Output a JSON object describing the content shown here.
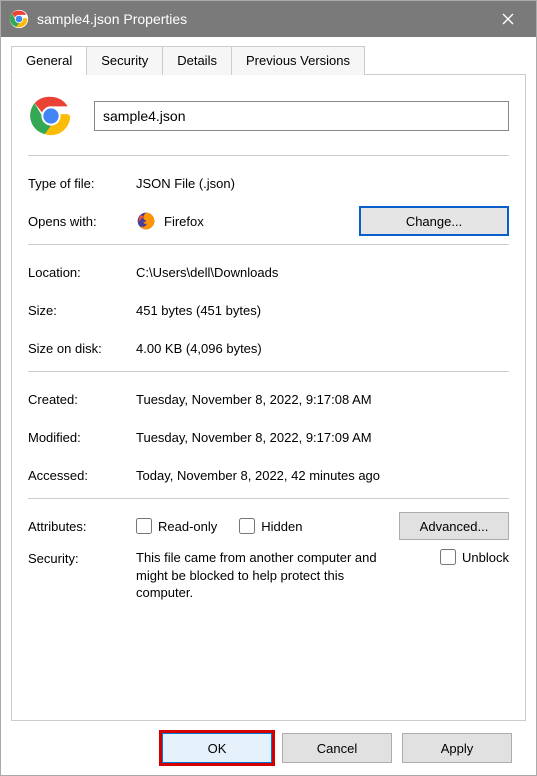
{
  "window": {
    "title": "sample4.json Properties"
  },
  "tabs": {
    "general": "General",
    "security": "Security",
    "details": "Details",
    "previous": "Previous Versions"
  },
  "general": {
    "filename": "sample4.json",
    "type_label": "Type of file:",
    "type_value": "JSON File (.json)",
    "opens_label": "Opens with:",
    "opens_value": "Firefox",
    "change_btn": "Change...",
    "location_label": "Location:",
    "location_value": "C:\\Users\\dell\\Downloads",
    "size_label": "Size:",
    "size_value": "451 bytes (451 bytes)",
    "sizeondisk_label": "Size on disk:",
    "sizeondisk_value": "4.00 KB (4,096 bytes)",
    "created_label": "Created:",
    "created_value": "Tuesday, November 8, 2022, 9:17:08 AM",
    "modified_label": "Modified:",
    "modified_value": "Tuesday, November 8, 2022, 9:17:09 AM",
    "accessed_label": "Accessed:",
    "accessed_value": "Today, November 8, 2022, 42 minutes ago",
    "attributes_label": "Attributes:",
    "readonly_label": "Read-only",
    "hidden_label": "Hidden",
    "advanced_btn": "Advanced...",
    "security_label": "Security:",
    "security_text": "This file came from another computer and might be blocked to help protect this computer.",
    "unblock_label": "Unblock"
  },
  "buttons": {
    "ok": "OK",
    "cancel": "Cancel",
    "apply": "Apply"
  }
}
